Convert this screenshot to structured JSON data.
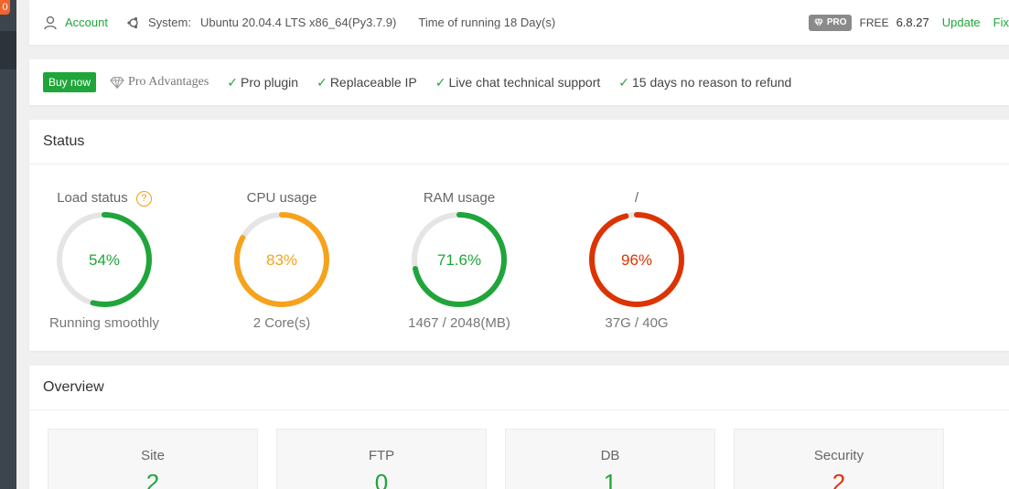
{
  "sidebar": {
    "badge": "0"
  },
  "topbar": {
    "account_label": "Account",
    "system_label": "System:",
    "system_value": "Ubuntu 20.04.4 LTS x86_64(Py3.7.9)",
    "runtime": "Time of running 18 Day(s)",
    "pro_badge": "PRO",
    "edition": "FREE",
    "version": "6.8.27",
    "update_label": "Update",
    "fix_label": "Fix"
  },
  "probar": {
    "buy_label": "Buy now",
    "advantages_label": "Pro Advantages",
    "features": [
      "Pro plugin",
      "Replaceable IP",
      "Live chat technical support",
      "15 days no reason to refund"
    ]
  },
  "status": {
    "title": "Status",
    "gauges": [
      {
        "title": "Load status",
        "value": "54%",
        "percent": 54,
        "subtitle": "Running smoothly",
        "color": "#20a53a",
        "has_help": true
      },
      {
        "title": "CPU usage",
        "value": "83%",
        "percent": 83,
        "subtitle": "2 Core(s)",
        "color": "#f7a21b"
      },
      {
        "title": "RAM usage",
        "value": "71.6%",
        "percent": 71.6,
        "subtitle": "1467 / 2048(MB)",
        "color": "#20a53a"
      },
      {
        "title": "/",
        "value": "96%",
        "percent": 96,
        "subtitle": "37G / 40G",
        "color": "#dd3300"
      }
    ],
    "help_symbol": "?"
  },
  "overview": {
    "title": "Overview",
    "boxes": [
      {
        "label": "Site",
        "value": "2",
        "color": "#20a53a"
      },
      {
        "label": "FTP",
        "value": "0",
        "color": "#20a53a"
      },
      {
        "label": "DB",
        "value": "1",
        "color": "#20a53a"
      },
      {
        "label": "Security",
        "value": "2",
        "color": "#dd3300"
      }
    ]
  },
  "colors": {
    "accent": "#20a53a",
    "warning": "#f7a21b",
    "danger": "#dd3300",
    "track": "#e5e5e5"
  }
}
